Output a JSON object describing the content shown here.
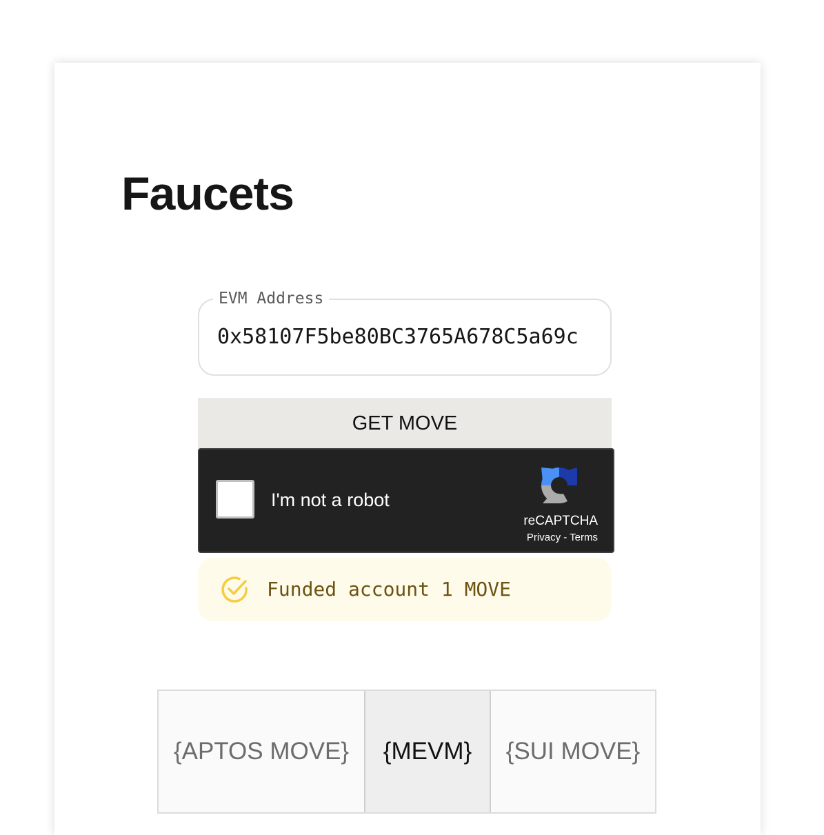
{
  "page": {
    "title": "Faucets"
  },
  "address_field": {
    "label": "EVM Address",
    "value": "0x58107F5be80BC3765A678C5a69c"
  },
  "get_button": {
    "label": "GET MOVE"
  },
  "recaptcha": {
    "label": "I'm not a robot",
    "brand": "reCAPTCHA",
    "privacy": "Privacy",
    "separator": "-",
    "terms": "Terms"
  },
  "status": {
    "message": "Funded account 1 MOVE"
  },
  "tabs": [
    {
      "label": "{APTOS MOVE}",
      "selected": false
    },
    {
      "label": "{MEVM}",
      "selected": true
    },
    {
      "label": "{SUI MOVE}",
      "selected": false
    }
  ],
  "colors": {
    "button_bg": "#eae9e5",
    "recaptcha_bg": "#222222",
    "success_bg": "#fffbeb",
    "success_text": "#6b5312",
    "success_icon": "#f6cd3c",
    "selected_tab_bg": "#edeeed"
  },
  "icons": {
    "status": "check-circle-icon",
    "recaptcha": "recaptcha-logo-icon"
  }
}
